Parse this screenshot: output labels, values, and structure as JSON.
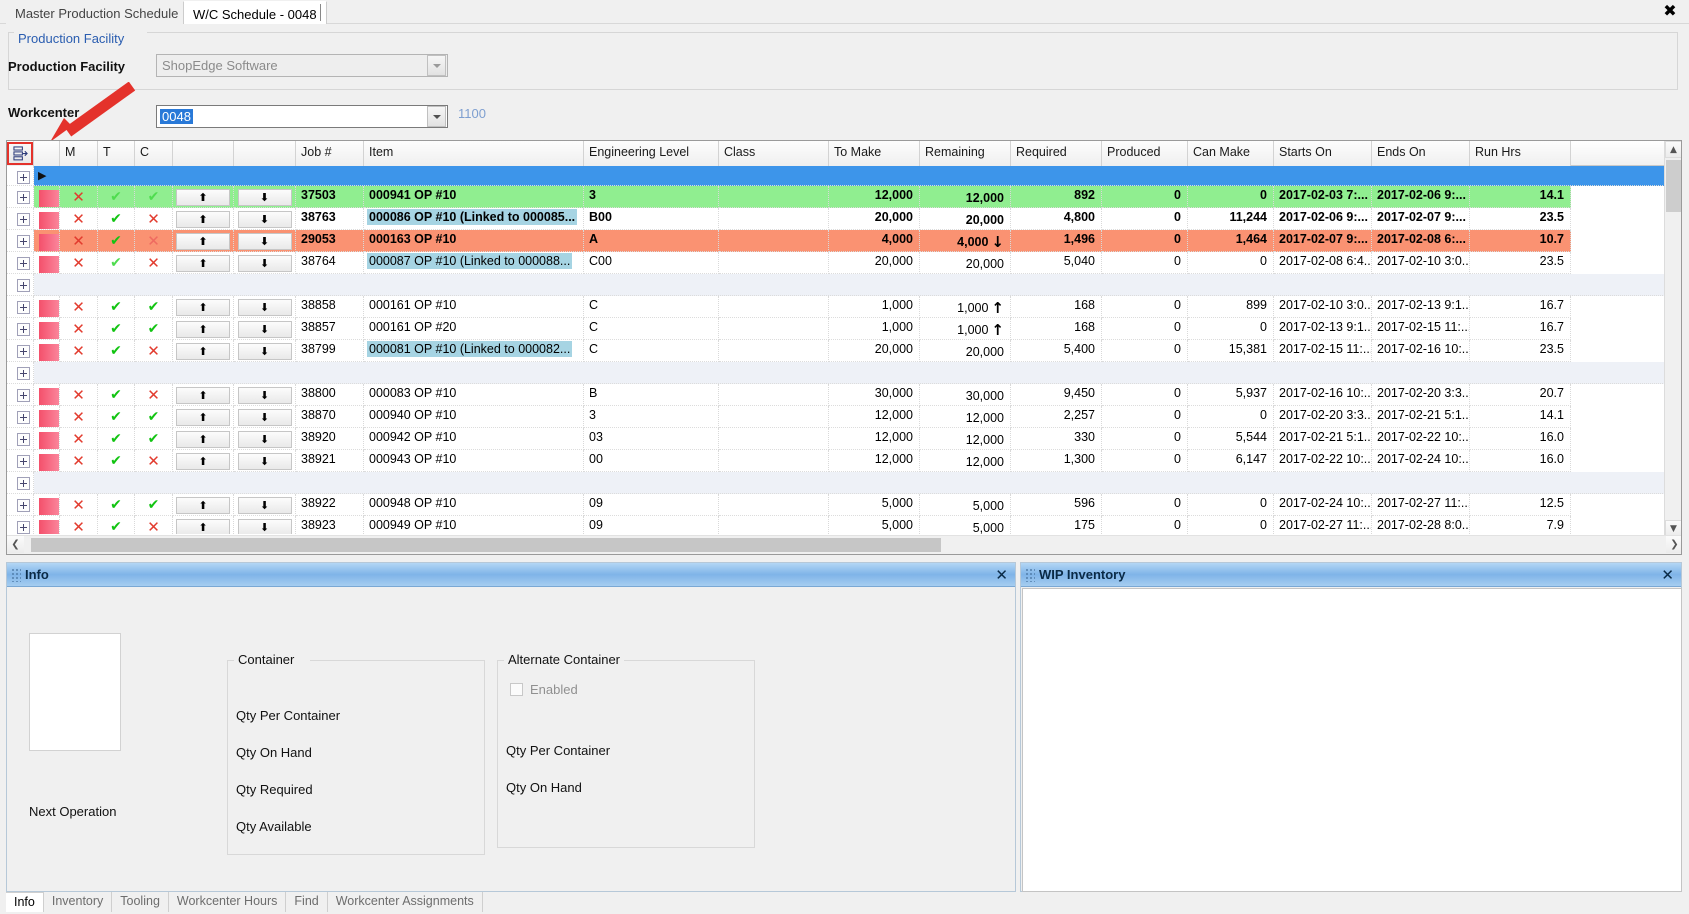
{
  "window": {
    "close_label": "✖"
  },
  "tabs": [
    {
      "label": "Master Production Schedule",
      "active": false
    },
    {
      "label": "W/C Schedule - 0048",
      "active": true
    }
  ],
  "production_facility_group": {
    "title": "Production Facility",
    "facility_label": "Production Facility",
    "facility_value": "ShopEdge Software",
    "facility_placeholder": "ShopEdge Software"
  },
  "workcenter": {
    "label": "Workcenter",
    "value": "0048",
    "code": "1100"
  },
  "grid": {
    "toolbar_icon": "grid-layout-icon",
    "columns": [
      {
        "key": "expander",
        "label": ""
      },
      {
        "key": "flag",
        "label": ""
      },
      {
        "key": "m",
        "label": "M"
      },
      {
        "key": "t",
        "label": "T"
      },
      {
        "key": "c",
        "label": "C"
      },
      {
        "key": "up",
        "label": ""
      },
      {
        "key": "down",
        "label": ""
      },
      {
        "key": "job",
        "label": "Job #"
      },
      {
        "key": "item",
        "label": "Item"
      },
      {
        "key": "eng",
        "label": "Engineering Level"
      },
      {
        "key": "class",
        "label": "Class"
      },
      {
        "key": "tomake",
        "label": "To Make"
      },
      {
        "key": "remaining",
        "label": "Remaining"
      },
      {
        "key": "required",
        "label": "Required"
      },
      {
        "key": "produced",
        "label": "Produced"
      },
      {
        "key": "canmake",
        "label": "Can Make"
      },
      {
        "key": "starts",
        "label": "Starts On"
      },
      {
        "key": "ends",
        "label": "Ends On"
      },
      {
        "key": "runhrs",
        "label": "Run Hrs"
      }
    ],
    "rows": [
      {
        "type": "selected",
        "rowcolor": "#3d95ea"
      },
      {
        "type": "data",
        "rowcolor": "#90ee90",
        "bold": true,
        "flag": "#f4506b",
        "m": "x",
        "t": "check-pale",
        "c": "check-pale",
        "job": "37503",
        "item": "000941 OP #10",
        "item_highlight": false,
        "eng": "3",
        "class": "",
        "tomake": "12,000",
        "remaining": "12,000",
        "trend": "",
        "required": "892",
        "produced": "0",
        "canmake": "0",
        "starts": "2017-02-03 7:...",
        "ends": "2017-02-06 9:...",
        "runhrs": "14.1"
      },
      {
        "type": "data",
        "rowcolor": "#ffffff",
        "bold": true,
        "flag": "#f4506b",
        "m": "x",
        "t": "check",
        "c": "x",
        "job": "38763",
        "item": "000086 OP #10 (Linked to 000085...",
        "item_highlight": true,
        "eng": "B00",
        "class": "",
        "tomake": "20,000",
        "remaining": "20,000",
        "trend": "",
        "required": "4,800",
        "produced": "0",
        "canmake": "11,244",
        "starts": "2017-02-06 9:...",
        "ends": "2017-02-07 9:...",
        "runhrs": "23.5"
      },
      {
        "type": "data",
        "rowcolor": "#fa9272",
        "bold": true,
        "flag": "#f4506b",
        "m": "x",
        "t": "check",
        "c": "x-pale",
        "job": "29053",
        "item": "000163 OP #10",
        "item_highlight": false,
        "eng": "A",
        "class": "",
        "tomake": "4,000",
        "remaining": "4,000",
        "trend": "down",
        "required": "1,496",
        "produced": "0",
        "canmake": "1,464",
        "starts": "2017-02-07 9:...",
        "ends": "2017-02-08 6:...",
        "runhrs": "10.7"
      },
      {
        "type": "data",
        "rowcolor": "#ffffff",
        "bold": false,
        "flag": "#f4506b",
        "m": "x",
        "t": "check-pale",
        "c": "x",
        "job": "38764",
        "item": "000087 OP #10 (Linked to 000088...",
        "item_highlight": true,
        "eng": "C00",
        "class": "",
        "tomake": "20,000",
        "remaining": "20,000",
        "trend": "",
        "required": "5,040",
        "produced": "0",
        "canmake": "0",
        "starts": "2017-02-08 6:4...",
        "ends": "2017-02-10 3:0...",
        "runhrs": "23.5"
      },
      {
        "type": "group",
        "rowcolor": "#eef1f7"
      },
      {
        "type": "data",
        "rowcolor": "#ffffff",
        "bold": false,
        "flag": "#f4506b",
        "m": "x",
        "t": "check",
        "c": "check",
        "job": "38858",
        "item": "000161 OP #10",
        "item_highlight": false,
        "eng": "C",
        "class": "",
        "tomake": "1,000",
        "remaining": "1,000",
        "trend": "up",
        "required": "168",
        "produced": "0",
        "canmake": "899",
        "starts": "2017-02-10 3:0...",
        "ends": "2017-02-13 9:1...",
        "runhrs": "16.7"
      },
      {
        "type": "data",
        "rowcolor": "#ffffff",
        "bold": false,
        "flag": "#f4506b",
        "m": "x",
        "t": "check",
        "c": "check",
        "job": "38857",
        "item": "000161 OP #20",
        "item_highlight": false,
        "eng": "C",
        "class": "",
        "tomake": "1,000",
        "remaining": "1,000",
        "trend": "up",
        "required": "168",
        "produced": "0",
        "canmake": "0",
        "starts": "2017-02-13 9:1...",
        "ends": "2017-02-15 11:...",
        "runhrs": "16.7"
      },
      {
        "type": "data",
        "rowcolor": "#ffffff",
        "bold": false,
        "flag": "#f4506b",
        "m": "x",
        "t": "check",
        "c": "x",
        "job": "38799",
        "item": "000081 OP #10 (Linked to 000082...",
        "item_highlight": true,
        "eng": "C",
        "class": "",
        "tomake": "20,000",
        "remaining": "20,000",
        "trend": "",
        "required": "5,400",
        "produced": "0",
        "canmake": "15,381",
        "starts": "2017-02-15 11:...",
        "ends": "2017-02-16 10:...",
        "runhrs": "23.5"
      },
      {
        "type": "group",
        "rowcolor": "#eef1f7"
      },
      {
        "type": "data",
        "rowcolor": "#ffffff",
        "bold": false,
        "flag": "#f4506b",
        "m": "x",
        "t": "check",
        "c": "x",
        "job": "38800",
        "item": "000083 OP #10",
        "item_highlight": false,
        "eng": "B",
        "class": "",
        "tomake": "30,000",
        "remaining": "30,000",
        "trend": "",
        "required": "9,450",
        "produced": "0",
        "canmake": "5,937",
        "starts": "2017-02-16 10:...",
        "ends": "2017-02-20 3:3...",
        "runhrs": "20.7"
      },
      {
        "type": "data",
        "rowcolor": "#ffffff",
        "bold": false,
        "flag": "#f4506b",
        "m": "x",
        "t": "check",
        "c": "check",
        "job": "38870",
        "item": "000940 OP #10",
        "item_highlight": false,
        "eng": "3",
        "class": "",
        "tomake": "12,000",
        "remaining": "12,000",
        "trend": "",
        "required": "2,257",
        "produced": "0",
        "canmake": "0",
        "starts": "2017-02-20 3:3...",
        "ends": "2017-02-21 5:1...",
        "runhrs": "14.1"
      },
      {
        "type": "data",
        "rowcolor": "#ffffff",
        "bold": false,
        "flag": "#f4506b",
        "m": "x",
        "t": "check",
        "c": "check",
        "job": "38920",
        "item": "000942 OP #10",
        "item_highlight": false,
        "eng": "03",
        "class": "",
        "tomake": "12,000",
        "remaining": "12,000",
        "trend": "",
        "required": "330",
        "produced": "0",
        "canmake": "5,544",
        "starts": "2017-02-21 5:1...",
        "ends": "2017-02-22 10:...",
        "runhrs": "16.0"
      },
      {
        "type": "data",
        "rowcolor": "#ffffff",
        "bold": false,
        "flag": "#f4506b",
        "m": "x",
        "t": "check",
        "c": "x",
        "job": "38921",
        "item": "000943 OP #10",
        "item_highlight": false,
        "eng": "00",
        "class": "",
        "tomake": "12,000",
        "remaining": "12,000",
        "trend": "",
        "required": "1,300",
        "produced": "0",
        "canmake": "6,147",
        "starts": "2017-02-22 10:...",
        "ends": "2017-02-24 10:...",
        "runhrs": "16.0"
      },
      {
        "type": "group",
        "rowcolor": "#eef1f7"
      },
      {
        "type": "data",
        "rowcolor": "#ffffff",
        "bold": false,
        "flag": "#f4506b",
        "m": "x",
        "t": "check",
        "c": "check",
        "job": "38922",
        "item": "000948 OP #10",
        "item_highlight": false,
        "eng": "09",
        "class": "",
        "tomake": "5,000",
        "remaining": "5,000",
        "trend": "",
        "required": "596",
        "produced": "0",
        "canmake": "0",
        "starts": "2017-02-24 10:...",
        "ends": "2017-02-27 11:...",
        "runhrs": "12.5"
      },
      {
        "type": "data",
        "rowcolor": "#ffffff",
        "bold": false,
        "flag": "#f4506b",
        "m": "x",
        "t": "check",
        "c": "x",
        "job": "38923",
        "item": "000949 OP #10",
        "item_highlight": false,
        "eng": "09",
        "class": "",
        "tomake": "5,000",
        "remaining": "5,000",
        "trend": "",
        "required": "175",
        "produced": "0",
        "canmake": "0",
        "starts": "2017-02-27 11:...",
        "ends": "2017-02-28 8:0...",
        "runhrs": "7.9"
      }
    ]
  },
  "info_panel": {
    "title": "Info",
    "close_label": "✕",
    "next_operation_label": "Next Operation",
    "container": {
      "title": "Container",
      "fields": [
        "Qty Per Container",
        "Qty On Hand",
        "Qty Required",
        "Qty Available"
      ]
    },
    "alternate_container": {
      "title": "Alternate Container",
      "enabled_label": "Enabled",
      "enabled_checked": false,
      "fields": [
        "Qty Per Container",
        "Qty On Hand"
      ]
    }
  },
  "wip_panel": {
    "title": "WIP Inventory",
    "close_label": "✕"
  },
  "bottom_tabs": [
    {
      "label": "Info",
      "active": true
    },
    {
      "label": "Inventory",
      "active": false
    },
    {
      "label": "Tooling",
      "active": false
    },
    {
      "label": "Workcenter Hours",
      "active": false
    },
    {
      "label": "Find",
      "active": false
    },
    {
      "label": "Workcenter Assignments",
      "active": false
    }
  ],
  "colors": {
    "accent_selected": "#3d95ea",
    "row_green": "#90ee90",
    "row_orange": "#fa9272",
    "item_highlight": "#a6d4e3",
    "flag_red": "#f4506b",
    "group_band": "#eef1f7",
    "link_blue": "#2a5db0",
    "annotation_red": "#e4322b"
  }
}
